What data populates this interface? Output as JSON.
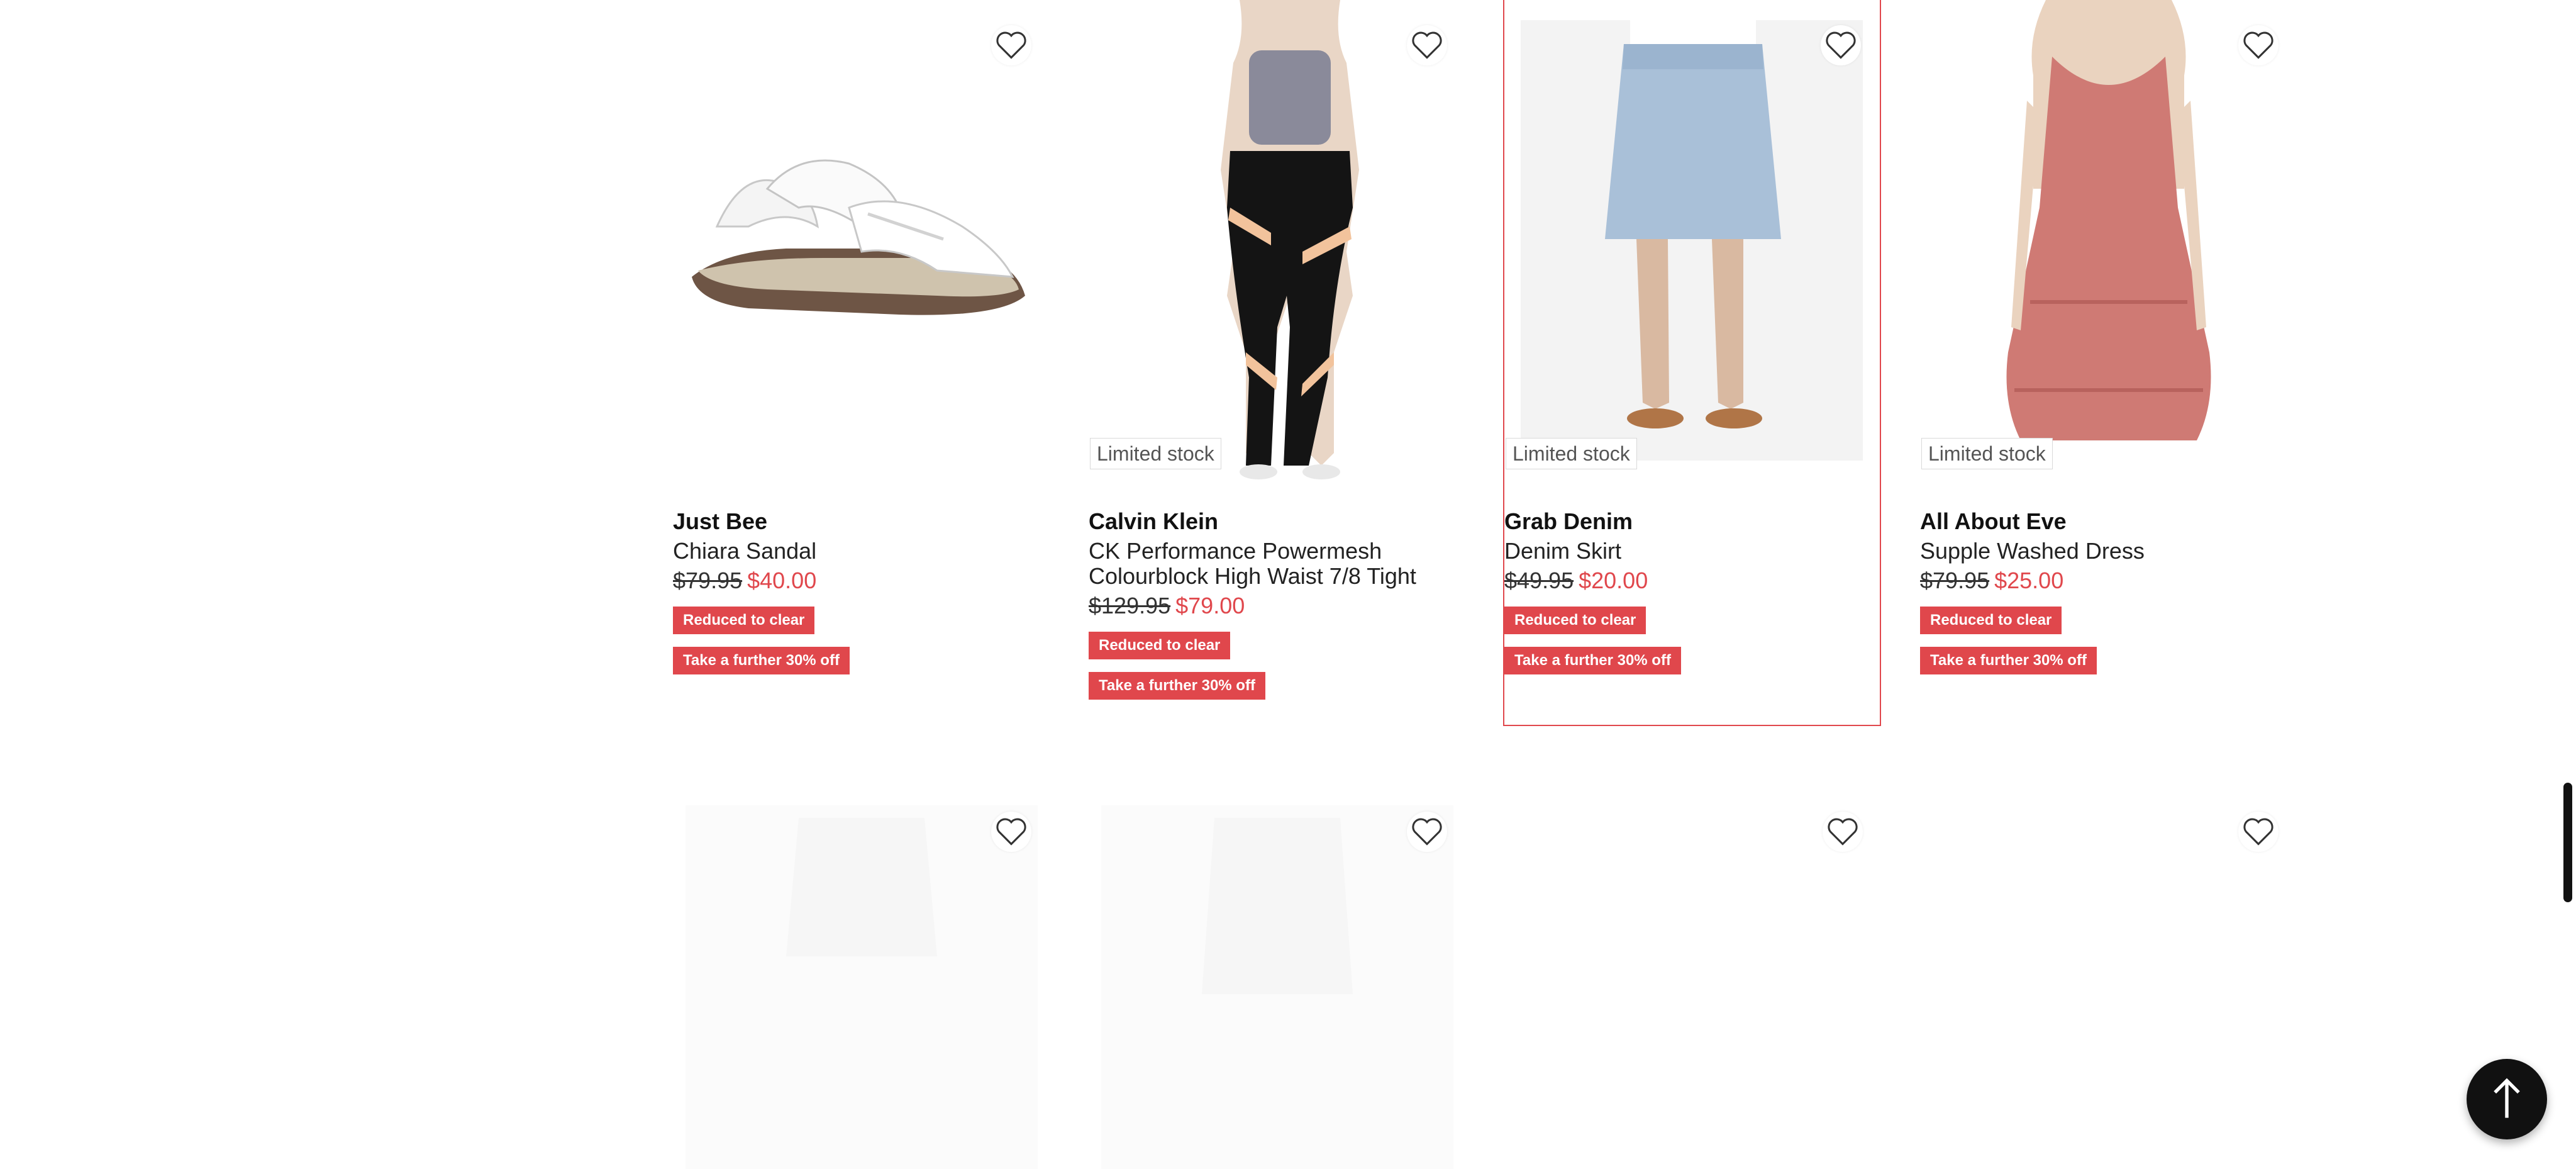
{
  "products": [
    {
      "brand": "Just Bee",
      "name": "Chiara Sandal",
      "was_price": "$79.95",
      "now_price": "$40.00",
      "limited_stock": "",
      "tags": [
        "Reduced to clear",
        "Take a further 30% off"
      ],
      "image": "white-sandal"
    },
    {
      "brand": "Calvin Klein",
      "name": "CK Performance Powermesh Colourblock High Waist 7/8 Tight",
      "was_price": "$129.95",
      "now_price": "$79.00",
      "limited_stock": "Limited stock",
      "tags": [
        "Reduced to clear",
        "Take a further 30% off"
      ],
      "image": "black-tights-model"
    },
    {
      "brand": "Grab Denim",
      "name": "Denim Skirt",
      "was_price": "$49.95",
      "now_price": "$20.00",
      "limited_stock": "Limited stock",
      "tags": [
        "Reduced to clear",
        "Take a further 30% off"
      ],
      "image": "denim-skirt-model"
    },
    {
      "brand": "All About Eve",
      "name": "Supple Washed Dress",
      "was_price": "$79.95",
      "now_price": "$25.00",
      "limited_stock": "Limited stock",
      "tags": [
        "Reduced to clear",
        "Take a further 30% off"
      ],
      "image": "pink-dress-model"
    }
  ],
  "loading_row_icons": [
    "heart-icon",
    "heart-icon",
    "heart-icon",
    "heart-icon"
  ],
  "colors": {
    "sale_red": "#e0474c",
    "text": "#1a1a1a",
    "back_to_top_bg": "#111111"
  },
  "icons": {
    "wishlist": "heart-icon",
    "back_to_top": "arrow-up-icon"
  }
}
